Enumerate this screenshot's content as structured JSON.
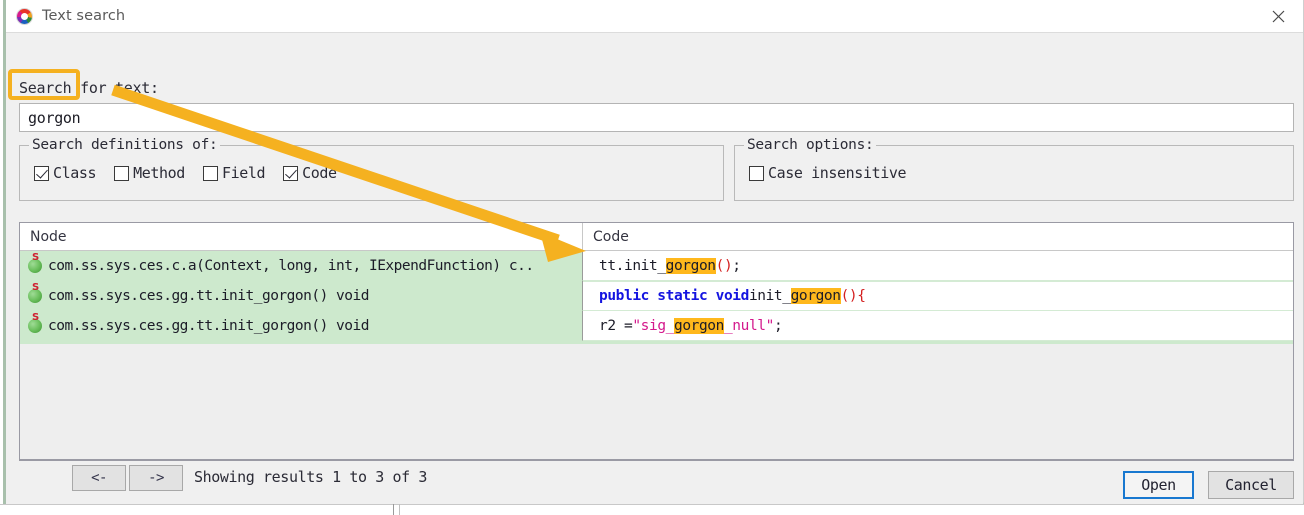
{
  "window": {
    "title": "Text search",
    "app_icon": "jadx-app-icon",
    "close_icon": "close-icon"
  },
  "search": {
    "label": "Search for text:",
    "value": "gorgon",
    "placeholder": ""
  },
  "definitions_group": {
    "legend": "Search definitions of:",
    "checkboxes": [
      {
        "label": "Class",
        "checked": true
      },
      {
        "label": "Method",
        "checked": false
      },
      {
        "label": "Field",
        "checked": false
      },
      {
        "label": "Code",
        "checked": true
      }
    ]
  },
  "options_group": {
    "legend": "Search options:",
    "checkboxes": [
      {
        "label": "Case insensitive",
        "checked": false
      }
    ]
  },
  "results": {
    "columns": [
      "Node",
      "Code"
    ],
    "rows": [
      {
        "icon": "static-method-icon",
        "node": "com.ss.sys.ces.c.a(Context, long, int, IExpendFunction) c..",
        "code_plain": "tt.init_gorgon();",
        "code_tokens": [
          {
            "t": "tt.init_",
            "k": "plain"
          },
          {
            "t": "gorgon",
            "k": "highlight"
          },
          {
            "t": "()",
            "k": "paren"
          },
          {
            "t": ";",
            "k": "plain"
          }
        ]
      },
      {
        "icon": "static-method-icon",
        "node": "com.ss.sys.ces.gg.tt.init_gorgon() void",
        "code_plain": "public static void init_gorgon() {",
        "code_tokens": [
          {
            "t": "public static void ",
            "k": "keyword"
          },
          {
            "t": "init_",
            "k": "plain"
          },
          {
            "t": "gorgon",
            "k": "highlight"
          },
          {
            "t": "()",
            "k": "paren"
          },
          {
            "t": " ",
            "k": "plain"
          },
          {
            "t": "{",
            "k": "paren"
          }
        ]
      },
      {
        "icon": "static-method-icon",
        "node": "com.ss.sys.ces.gg.tt.init_gorgon() void",
        "code_plain": "r2 = \"sig_gorgon_null\";",
        "code_tokens": [
          {
            "t": "r2 = ",
            "k": "plain"
          },
          {
            "t": "\"sig_",
            "k": "string"
          },
          {
            "t": "gorgon",
            "k": "highlight"
          },
          {
            "t": "_null\"",
            "k": "string"
          },
          {
            "t": ";",
            "k": "plain"
          }
        ]
      }
    ]
  },
  "pager": {
    "prev_label": "<-",
    "next_label": "->",
    "status": "Showing results 1 to 3 of 3"
  },
  "footer": {
    "open_label": "Open",
    "cancel_label": "Cancel"
  },
  "annotation": {
    "highlight_color": "#f5b120",
    "arrow_from": "search-input",
    "arrow_to": "results-code-column"
  }
}
